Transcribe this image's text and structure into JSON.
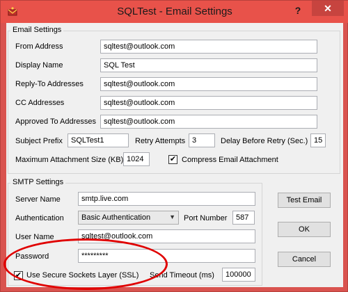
{
  "window": {
    "title": "SQLTest - Email Settings",
    "help_glyph": "?",
    "close_glyph": "✕"
  },
  "email_settings": {
    "group_label": "Email Settings",
    "from_address": {
      "label": "From Address",
      "value": "sqltest@outlook.com"
    },
    "display_name": {
      "label": "Display Name",
      "value": "SQL Test"
    },
    "reply_to": {
      "label": "Reply-To Addresses",
      "value": "sqltest@outlook.com"
    },
    "cc": {
      "label": "CC Addresses",
      "value": "sqltest@outlook.com"
    },
    "approved_to": {
      "label": "Approved To Addresses",
      "value": "sqltest@outlook.com"
    },
    "subject_prefix": {
      "label": "Subject Prefix",
      "value": "SQLTest1"
    },
    "retry_attempts": {
      "label": "Retry Attempts",
      "value": "3"
    },
    "delay_before_retry": {
      "label": "Delay Before Retry (Sec.)",
      "value": "15"
    },
    "max_attachment_size": {
      "label": "Maximum Attachment Size (KB)",
      "value": "1024"
    },
    "compress_attachment": {
      "label": "Compress Email Attachment",
      "checked": true,
      "check_glyph": "✔"
    }
  },
  "smtp_settings": {
    "group_label": "SMTP Settings",
    "server_name": {
      "label": "Server Name",
      "value": "smtp.live.com"
    },
    "authentication": {
      "label": "Authentication",
      "selected": "Basic Authentication"
    },
    "port_number": {
      "label": "Port Number",
      "value": "587"
    },
    "user_name": {
      "label": "User Name",
      "value": "sqltest@outlook.com"
    },
    "password": {
      "label": "Password",
      "value": "*********"
    },
    "use_ssl": {
      "label": "Use Secure Sockets Layer (SSL)",
      "checked": true,
      "check_glyph": "✔"
    },
    "send_timeout": {
      "label": "Send Timeout (ms)",
      "value": "100000"
    }
  },
  "buttons": {
    "test_email": "Test Email",
    "ok": "OK",
    "cancel": "Cancel"
  },
  "colors": {
    "title_bar": "#e8524a",
    "close_button": "#c7443f",
    "annotation": "#e00000"
  }
}
